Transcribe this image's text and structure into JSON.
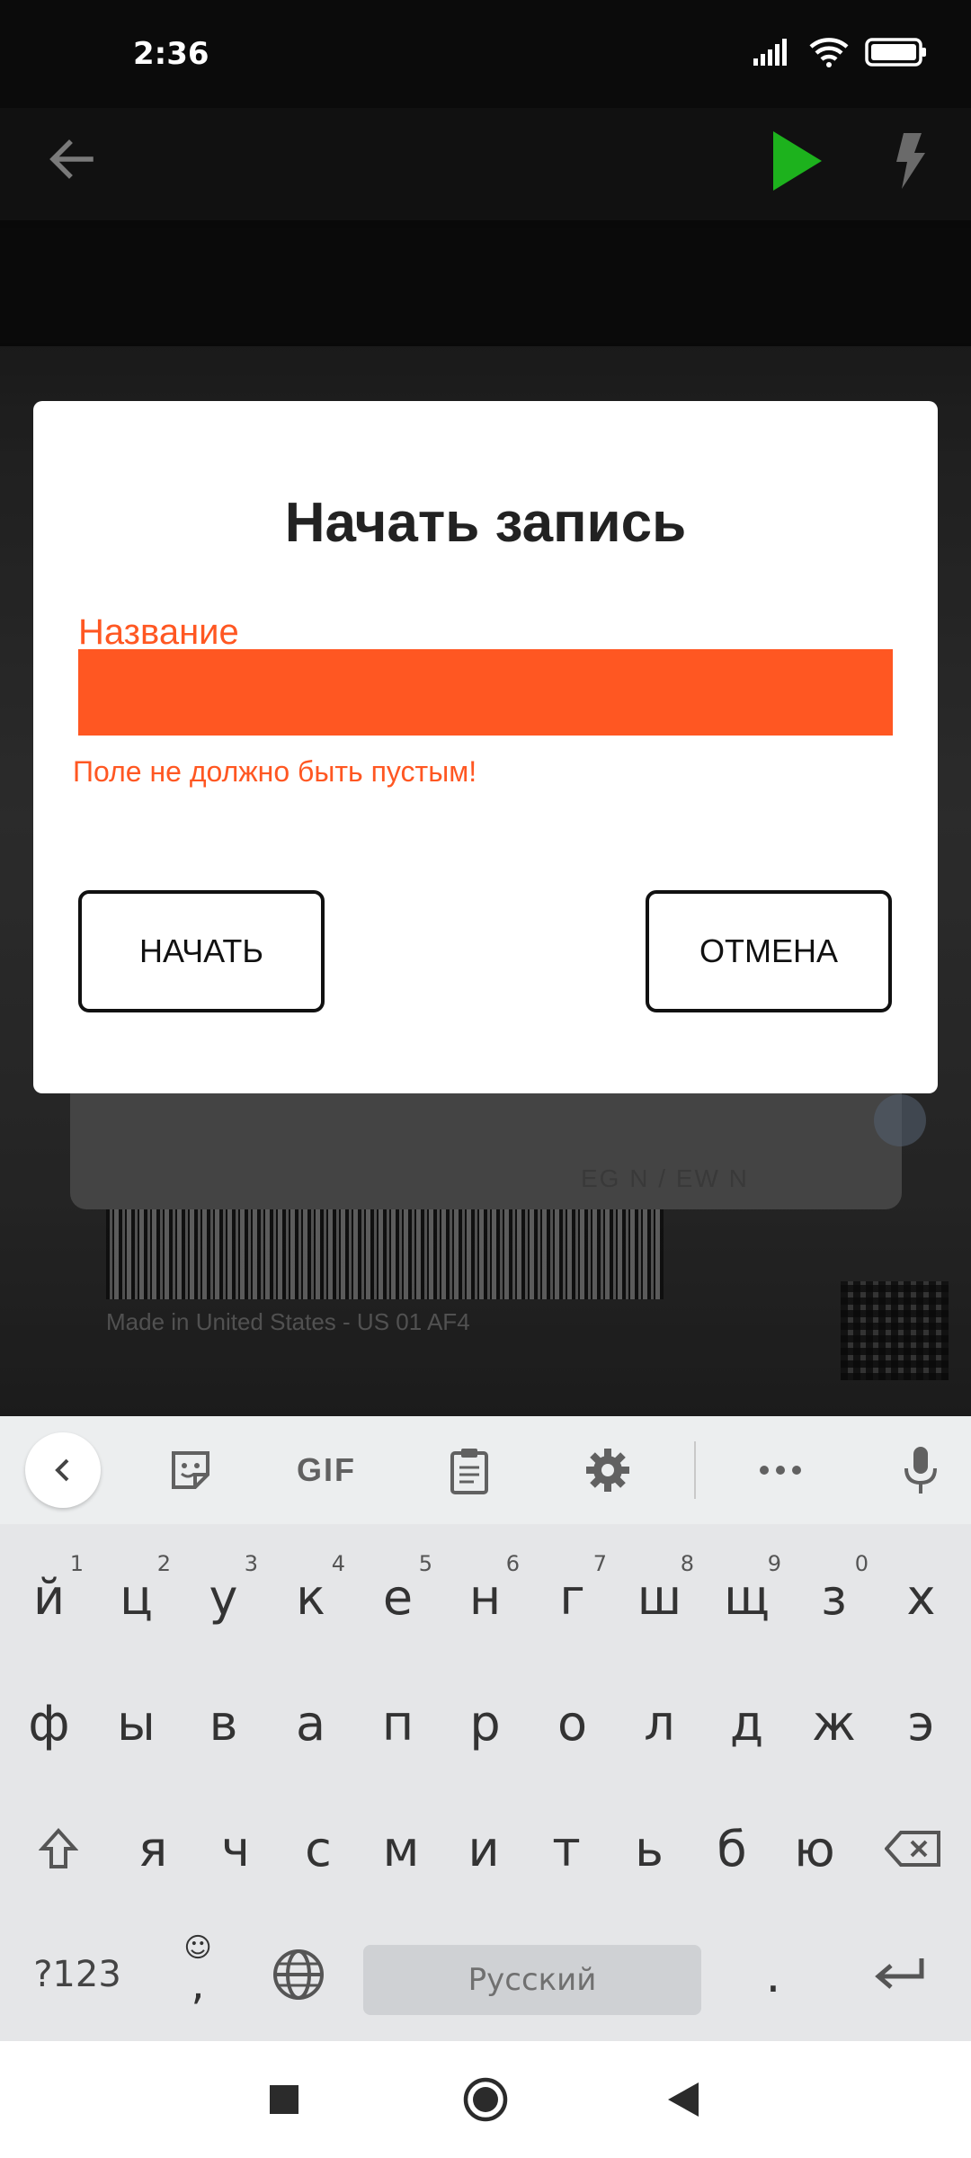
{
  "status": {
    "time": "2:36"
  },
  "dialog": {
    "title": "Начать запись",
    "field_label": "Название",
    "field_value": "",
    "error": "Поле не должно быть пустым!",
    "start_label": "НАЧАТЬ",
    "cancel_label": "ОТМЕНА"
  },
  "camera": {
    "egn_text": "EG N / EW N",
    "made_text": "Made in United States - US      01    AF4"
  },
  "keyboard": {
    "toolbar": {
      "gif_label": "GIF"
    },
    "row1": [
      {
        "k": "й",
        "n": "1"
      },
      {
        "k": "ц",
        "n": "2"
      },
      {
        "k": "у",
        "n": "3"
      },
      {
        "k": "к",
        "n": "4"
      },
      {
        "k": "е",
        "n": "5"
      },
      {
        "k": "н",
        "n": "6"
      },
      {
        "k": "г",
        "n": "7"
      },
      {
        "k": "ш",
        "n": "8"
      },
      {
        "k": "щ",
        "n": "9"
      },
      {
        "k": "з",
        "n": "0"
      },
      {
        "k": "х",
        "n": ""
      }
    ],
    "row2": [
      "ф",
      "ы",
      "в",
      "а",
      "п",
      "р",
      "о",
      "л",
      "д",
      "ж",
      "э"
    ],
    "row3": [
      "я",
      "ч",
      "с",
      "м",
      "и",
      "т",
      "ь",
      "б",
      "ю"
    ],
    "symbols_label": "?123",
    "comma_label": ",",
    "space_label": "Русский",
    "period_label": "."
  },
  "colors": {
    "accent": "#ff5722",
    "play": "#1db21d"
  }
}
